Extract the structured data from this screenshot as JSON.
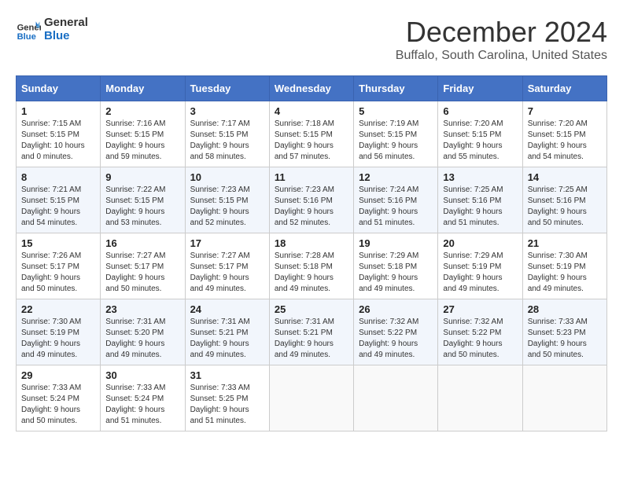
{
  "logo": {
    "line1": "General",
    "line2": "Blue"
  },
  "title": "December 2024",
  "location": "Buffalo, South Carolina, United States",
  "days_header": [
    "Sunday",
    "Monday",
    "Tuesday",
    "Wednesday",
    "Thursday",
    "Friday",
    "Saturday"
  ],
  "weeks": [
    [
      {
        "day": "1",
        "sunrise": "7:15 AM",
        "sunset": "5:15 PM",
        "daylight": "10 hours and 0 minutes."
      },
      {
        "day": "2",
        "sunrise": "7:16 AM",
        "sunset": "5:15 PM",
        "daylight": "9 hours and 59 minutes."
      },
      {
        "day": "3",
        "sunrise": "7:17 AM",
        "sunset": "5:15 PM",
        "daylight": "9 hours and 58 minutes."
      },
      {
        "day": "4",
        "sunrise": "7:18 AM",
        "sunset": "5:15 PM",
        "daylight": "9 hours and 57 minutes."
      },
      {
        "day": "5",
        "sunrise": "7:19 AM",
        "sunset": "5:15 PM",
        "daylight": "9 hours and 56 minutes."
      },
      {
        "day": "6",
        "sunrise": "7:20 AM",
        "sunset": "5:15 PM",
        "daylight": "9 hours and 55 minutes."
      },
      {
        "day": "7",
        "sunrise": "7:20 AM",
        "sunset": "5:15 PM",
        "daylight": "9 hours and 54 minutes."
      }
    ],
    [
      {
        "day": "8",
        "sunrise": "7:21 AM",
        "sunset": "5:15 PM",
        "daylight": "9 hours and 54 minutes."
      },
      {
        "day": "9",
        "sunrise": "7:22 AM",
        "sunset": "5:15 PM",
        "daylight": "9 hours and 53 minutes."
      },
      {
        "day": "10",
        "sunrise": "7:23 AM",
        "sunset": "5:15 PM",
        "daylight": "9 hours and 52 minutes."
      },
      {
        "day": "11",
        "sunrise": "7:23 AM",
        "sunset": "5:16 PM",
        "daylight": "9 hours and 52 minutes."
      },
      {
        "day": "12",
        "sunrise": "7:24 AM",
        "sunset": "5:16 PM",
        "daylight": "9 hours and 51 minutes."
      },
      {
        "day": "13",
        "sunrise": "7:25 AM",
        "sunset": "5:16 PM",
        "daylight": "9 hours and 51 minutes."
      },
      {
        "day": "14",
        "sunrise": "7:25 AM",
        "sunset": "5:16 PM",
        "daylight": "9 hours and 50 minutes."
      }
    ],
    [
      {
        "day": "15",
        "sunrise": "7:26 AM",
        "sunset": "5:17 PM",
        "daylight": "9 hours and 50 minutes."
      },
      {
        "day": "16",
        "sunrise": "7:27 AM",
        "sunset": "5:17 PM",
        "daylight": "9 hours and 50 minutes."
      },
      {
        "day": "17",
        "sunrise": "7:27 AM",
        "sunset": "5:17 PM",
        "daylight": "9 hours and 49 minutes."
      },
      {
        "day": "18",
        "sunrise": "7:28 AM",
        "sunset": "5:18 PM",
        "daylight": "9 hours and 49 minutes."
      },
      {
        "day": "19",
        "sunrise": "7:29 AM",
        "sunset": "5:18 PM",
        "daylight": "9 hours and 49 minutes."
      },
      {
        "day": "20",
        "sunrise": "7:29 AM",
        "sunset": "5:19 PM",
        "daylight": "9 hours and 49 minutes."
      },
      {
        "day": "21",
        "sunrise": "7:30 AM",
        "sunset": "5:19 PM",
        "daylight": "9 hours and 49 minutes."
      }
    ],
    [
      {
        "day": "22",
        "sunrise": "7:30 AM",
        "sunset": "5:19 PM",
        "daylight": "9 hours and 49 minutes."
      },
      {
        "day": "23",
        "sunrise": "7:31 AM",
        "sunset": "5:20 PM",
        "daylight": "9 hours and 49 minutes."
      },
      {
        "day": "24",
        "sunrise": "7:31 AM",
        "sunset": "5:21 PM",
        "daylight": "9 hours and 49 minutes."
      },
      {
        "day": "25",
        "sunrise": "7:31 AM",
        "sunset": "5:21 PM",
        "daylight": "9 hours and 49 minutes."
      },
      {
        "day": "26",
        "sunrise": "7:32 AM",
        "sunset": "5:22 PM",
        "daylight": "9 hours and 49 minutes."
      },
      {
        "day": "27",
        "sunrise": "7:32 AM",
        "sunset": "5:22 PM",
        "daylight": "9 hours and 50 minutes."
      },
      {
        "day": "28",
        "sunrise": "7:33 AM",
        "sunset": "5:23 PM",
        "daylight": "9 hours and 50 minutes."
      }
    ],
    [
      {
        "day": "29",
        "sunrise": "7:33 AM",
        "sunset": "5:24 PM",
        "daylight": "9 hours and 50 minutes."
      },
      {
        "day": "30",
        "sunrise": "7:33 AM",
        "sunset": "5:24 PM",
        "daylight": "9 hours and 51 minutes."
      },
      {
        "day": "31",
        "sunrise": "7:33 AM",
        "sunset": "5:25 PM",
        "daylight": "9 hours and 51 minutes."
      },
      null,
      null,
      null,
      null
    ]
  ]
}
